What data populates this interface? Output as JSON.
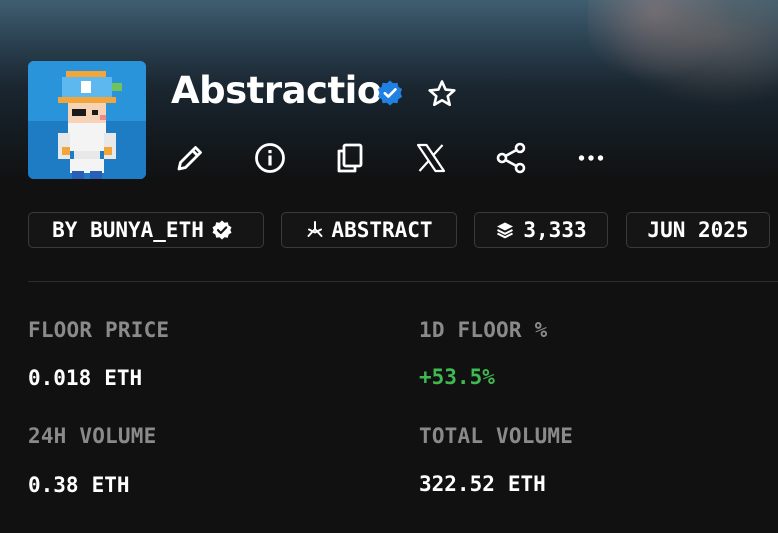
{
  "collection": {
    "name": "Abstractio",
    "verified": true
  },
  "actions": [
    {
      "name": "edit",
      "icon": "pencil-icon"
    },
    {
      "name": "info",
      "icon": "info-icon"
    },
    {
      "name": "copy",
      "icon": "copy-icon"
    },
    {
      "name": "x",
      "icon": "x-logo-icon"
    },
    {
      "name": "share",
      "icon": "share-icon"
    },
    {
      "name": "more",
      "icon": "more-horizontal-icon"
    }
  ],
  "chips": {
    "creator": "BY BUNYA_ETH",
    "chain": "ABSTRACT",
    "items": "3,333",
    "date": "JUN 2025"
  },
  "stats": {
    "floor_price": {
      "label": "FLOOR PRICE",
      "value": "0.018",
      "unit": "ETH"
    },
    "floor_change": {
      "label": "1D FLOOR %",
      "value": "+53.5%"
    },
    "volume_24h": {
      "label": "24H VOLUME",
      "value": "0.38",
      "unit": "ETH"
    },
    "total_volume": {
      "label": "TOTAL VOLUME",
      "value": "322.52",
      "unit": "ETH"
    }
  },
  "colors": {
    "background": "#111111",
    "verified_badge": "#2081e2",
    "positive": "#3fb950",
    "muted_label": "#8a8a8a"
  }
}
